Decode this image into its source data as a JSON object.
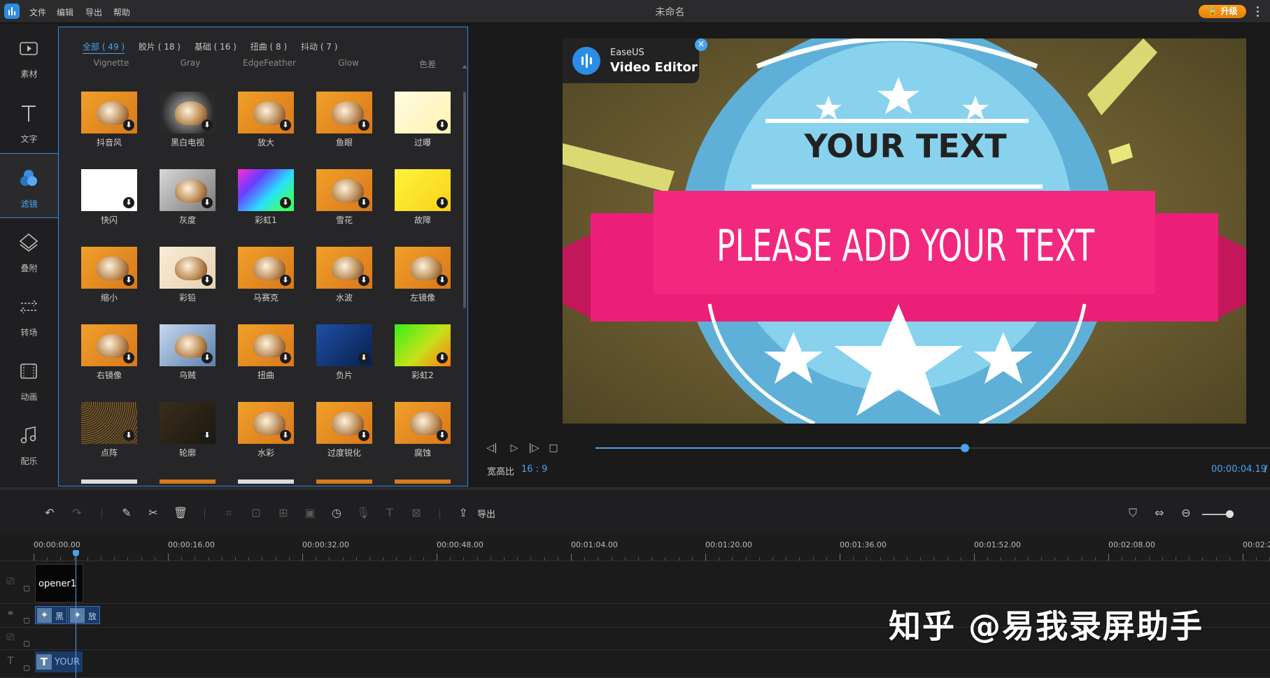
{
  "app": {
    "window_title": "未命名",
    "menu": [
      "文件",
      "编辑",
      "导出",
      "帮助"
    ],
    "upgrade_label": "🔒 升级",
    "accent": "#2d8ce3"
  },
  "sidebar": {
    "items": [
      {
        "label": "素材",
        "icon": "media-icon"
      },
      {
        "label": "文字",
        "icon": "text-icon"
      },
      {
        "label": "滤镜",
        "icon": "filter-icon",
        "active": true
      },
      {
        "label": "叠附",
        "icon": "overlay-icon"
      },
      {
        "label": "转场",
        "icon": "transition-icon"
      },
      {
        "label": "动画",
        "icon": "animation-icon"
      },
      {
        "label": "配乐",
        "icon": "music-icon"
      }
    ]
  },
  "filters": {
    "tabs": [
      "全部 ( 49 )",
      "胶片 ( 18 )",
      "基础 ( 16 )",
      "扭曲 ( 8 )",
      "抖动 ( 7 )"
    ],
    "active_tab": 0,
    "cut_off_labels": [
      "Vignette",
      "Gray",
      "EdgeFeather",
      "Glow",
      "色差"
    ],
    "items": [
      {
        "label": "抖音风",
        "style": "warm"
      },
      {
        "label": "黑白电视",
        "style": "bw"
      },
      {
        "label": "放大",
        "style": "warm"
      },
      {
        "label": "鱼眼",
        "style": "warm"
      },
      {
        "label": "过曝",
        "style": "bright"
      },
      {
        "label": "快闪",
        "style": "white"
      },
      {
        "label": "灰度",
        "style": "gray"
      },
      {
        "label": "彩虹1",
        "style": "rainbow"
      },
      {
        "label": "雪花",
        "style": "warm"
      },
      {
        "label": "故障",
        "style": "yellow"
      },
      {
        "label": "缩小",
        "style": "warm"
      },
      {
        "label": "彩铅",
        "style": "pale"
      },
      {
        "label": "马赛克",
        "style": "warm"
      },
      {
        "label": "水波",
        "style": "warm"
      },
      {
        "label": "左镜像",
        "style": "warm"
      },
      {
        "label": "右镜像",
        "style": "warm"
      },
      {
        "label": "乌贼",
        "style": "blue"
      },
      {
        "label": "扭曲",
        "style": "warm"
      },
      {
        "label": "负片",
        "style": "negative"
      },
      {
        "label": "彩虹2",
        "style": "green"
      },
      {
        "label": "点阵",
        "style": "dots"
      },
      {
        "label": "轮廓",
        "style": "dark"
      },
      {
        "label": "水彩",
        "style": "warm"
      },
      {
        "label": "过度锐化",
        "style": "warm"
      },
      {
        "label": "腐蚀",
        "style": "warm"
      }
    ]
  },
  "preview": {
    "watermark_brand": "EaseUS",
    "watermark_product": "Video Editor",
    "badge_top_text": "YOUR TEXT",
    "badge_banner_text": "PLEASE ADD YOUR TEXT",
    "aspect_label": "宽高比",
    "aspect_value": "16 : 9",
    "time": "00:00:04.19",
    "time_sep": "/",
    "progress": 0.536
  },
  "toolbar": {
    "export_label": "导出",
    "zoom_level": 0.8
  },
  "timeline": {
    "ruler_labels": [
      "00:00:00.00",
      "00:00:16.00",
      "00:00:32.00",
      "00:00:48.00",
      "00:01:04.00",
      "00:01:20.00",
      "00:01:36.00",
      "00:01:52.00",
      "00:02:08.00",
      "00:02:2"
    ],
    "video_clip": "opener1",
    "fx_clips": [
      "黑",
      "放"
    ],
    "text_clip": "YOUR"
  },
  "overlay_watermark": "知乎 @易我录屏助手"
}
